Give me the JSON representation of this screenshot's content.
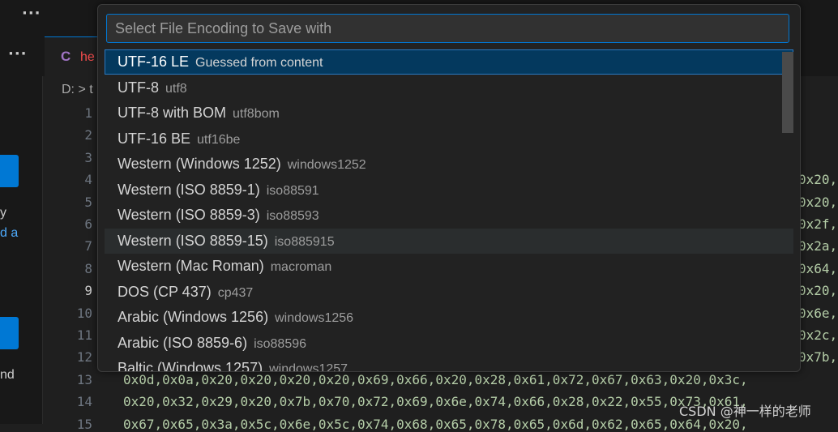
{
  "topbar": {
    "more_icon": "ellipsis-icon"
  },
  "sidebar": {
    "more_icon": "ellipsis-icon",
    "text_frag1": "y",
    "link_frag1": "d a",
    "text_frag2": "nd"
  },
  "tab": {
    "icon_letter": "C",
    "name": "he"
  },
  "breadcrumb": {
    "drive": "D:",
    "separator": ">",
    "next": "t"
  },
  "line_numbers": [
    "1",
    "2",
    "3",
    "4",
    "5",
    "6",
    "7",
    "8",
    "9",
    "10",
    "11",
    "12",
    "13",
    "14",
    "15"
  ],
  "code_right": [
    "0x20,",
    "0x20,",
    "0x2f,",
    "0x2a,",
    "0x64,",
    "0x20,",
    "0x6e,",
    "0x2c,",
    "0x7b,"
  ],
  "code_full": [
    "0x0d,0x0a,0x20,0x20,0x20,0x20,0x69,0x66,0x20,0x28,0x61,0x72,0x67,0x63,0x20,0x3c,",
    "0x20,0x32,0x29,0x20,0x7b,0x70,0x72,0x69,0x6e,0x74,0x66,0x28,0x22,0x55,0x73,0x61,",
    "0x67,0x65,0x3a,0x5c,0x6e,0x5c,0x74,0x68,0x65,0x78,0x65,0x6d,0x62,0x65,0x64,0x20,"
  ],
  "watermark": "CSDN @神一样的老师",
  "quickpick": {
    "placeholder": "Select File Encoding to Save with",
    "items": [
      {
        "label": "UTF-16 LE",
        "desc": "Guessed from content"
      },
      {
        "label": "UTF-8",
        "desc": "utf8"
      },
      {
        "label": "UTF-8 with BOM",
        "desc": "utf8bom"
      },
      {
        "label": "UTF-16 BE",
        "desc": "utf16be"
      },
      {
        "label": "Western (Windows 1252)",
        "desc": "windows1252"
      },
      {
        "label": "Western (ISO 8859-1)",
        "desc": "iso88591"
      },
      {
        "label": "Western (ISO 8859-3)",
        "desc": "iso88593"
      },
      {
        "label": "Western (ISO 8859-15)",
        "desc": "iso885915"
      },
      {
        "label": "Western (Mac Roman)",
        "desc": "macroman"
      },
      {
        "label": "DOS (CP 437)",
        "desc": "cp437"
      },
      {
        "label": "Arabic (Windows 1256)",
        "desc": "windows1256"
      },
      {
        "label": "Arabic (ISO 8859-6)",
        "desc": "iso88596"
      },
      {
        "label": "Baltic (Windows 1257)",
        "desc": "windows1257"
      }
    ]
  }
}
